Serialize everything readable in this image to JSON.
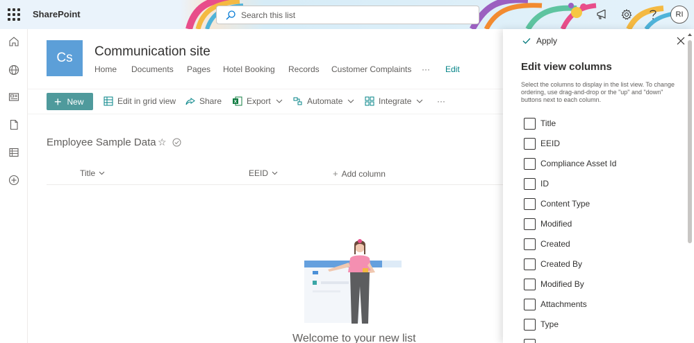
{
  "suite": {
    "brand": "SharePoint",
    "search_placeholder": "Search this list",
    "avatar_initials": "RI"
  },
  "site": {
    "logo_initials": "Cs",
    "title": "Communication site",
    "nav": [
      "Home",
      "Documents",
      "Pages",
      "Hotel Booking",
      "Records",
      "Customer Complaints"
    ],
    "nav_more": "···",
    "nav_edit": "Edit"
  },
  "commands": {
    "new": "New",
    "edit_grid": "Edit in grid view",
    "share": "Share",
    "export": "Export",
    "automate": "Automate",
    "integrate": "Integrate",
    "more": "···"
  },
  "list": {
    "title": "Employee Sample Data",
    "columns": [
      "Title",
      "EEID"
    ],
    "add_column": "Add column",
    "welcome": "Welcome to your new list"
  },
  "panel": {
    "apply": "Apply",
    "title": "Edit view columns",
    "description": "Select the columns to display in the list view. To change ordering, use drag-and-drop or the \"up\" and \"down\" buttons next to each column.",
    "columns": [
      {
        "label": "Title",
        "checked": true
      },
      {
        "label": "EEID",
        "checked": true
      },
      {
        "label": "Compliance Asset Id",
        "checked": false
      },
      {
        "label": "ID",
        "checked": false
      },
      {
        "label": "Content Type",
        "checked": false
      },
      {
        "label": "Modified",
        "checked": false
      },
      {
        "label": "Created",
        "checked": false
      },
      {
        "label": "Created By",
        "checked": false
      },
      {
        "label": "Modified By",
        "checked": false
      },
      {
        "label": "Attachments",
        "checked": false
      },
      {
        "label": "Type",
        "checked": false
      }
    ]
  },
  "colors": {
    "accent": "#03787c",
    "new_button": "#4f9a9c",
    "site_logo": "#5c9fd8"
  }
}
